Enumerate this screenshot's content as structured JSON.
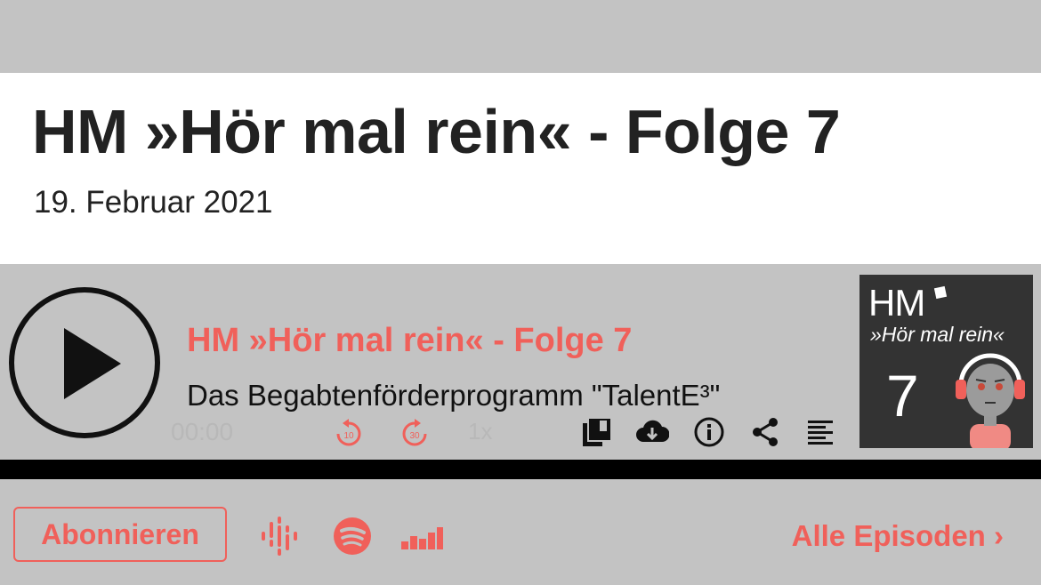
{
  "page": {
    "title": "HM »Hör mal rein« - Folge 7",
    "date": "19. Februar 2021"
  },
  "player": {
    "episode_title": "HM »Hör mal rein« - Folge 7",
    "episode_subtitle": "Das Begabtenförderprogramm \"TalentE³\"",
    "current_time": "00:00",
    "playback_rate": "1x",
    "skip_back_seconds": "10",
    "skip_forward_seconds": "30",
    "cover": {
      "brand": "HM",
      "show": "»Hör mal rein«",
      "number": "7"
    },
    "controls": [
      "chapters-icon",
      "download-icon",
      "info-icon",
      "share-icon",
      "transcript-icon"
    ]
  },
  "footer": {
    "subscribe_label": "Abonnieren",
    "platforms": [
      "google-podcasts-icon",
      "spotify-icon",
      "deezer-icon"
    ],
    "all_episodes_label": "Alle Episoden ›"
  },
  "colors": {
    "accent": "#f0605a",
    "background": "#c3c3c3",
    "dark": "#111111"
  }
}
